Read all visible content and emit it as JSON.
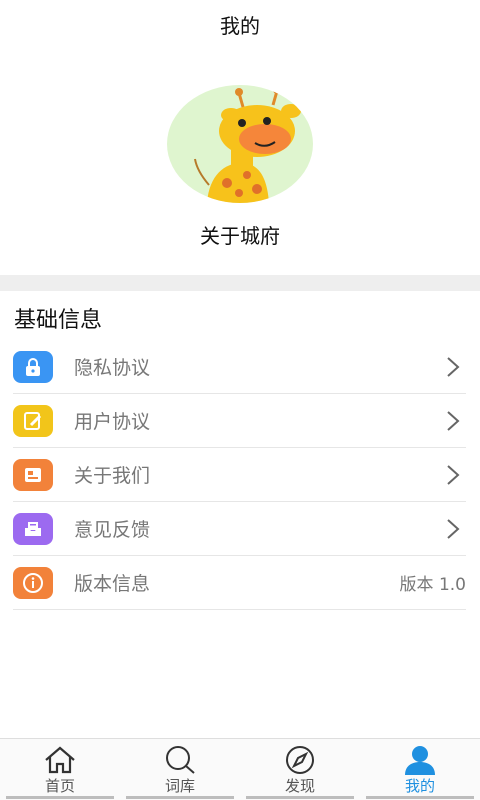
{
  "header": {
    "title": "我的"
  },
  "profile": {
    "name": "关于城府",
    "avatar_icon": "giraffe-avatar"
  },
  "section": {
    "title": "基础信息"
  },
  "menu": [
    {
      "label": "隐私协议",
      "icon": "lock-icon",
      "color": "#3a95f3",
      "trailing": "chevron"
    },
    {
      "label": "用户协议",
      "icon": "note-edit-icon",
      "color": "#f2c51a",
      "trailing": "chevron"
    },
    {
      "label": "关于我们",
      "icon": "document-icon",
      "color": "#f2823a",
      "trailing": "chevron"
    },
    {
      "label": "意见反馈",
      "icon": "message-tray-icon",
      "color": "#9c6af0",
      "trailing": "chevron"
    },
    {
      "label": "版本信息",
      "icon": "info-icon",
      "color": "#f2823a",
      "trailing": "版本 1.0"
    }
  ],
  "tabs": [
    {
      "label": "首页",
      "icon": "home-icon",
      "active": false
    },
    {
      "label": "词库",
      "icon": "search-icon",
      "active": false
    },
    {
      "label": "发现",
      "icon": "compass-icon",
      "active": false
    },
    {
      "label": "我的",
      "icon": "user-icon",
      "active": true
    }
  ],
  "colors": {
    "active_tab": "#1f90e0",
    "background_gap": "#eeeeee"
  }
}
